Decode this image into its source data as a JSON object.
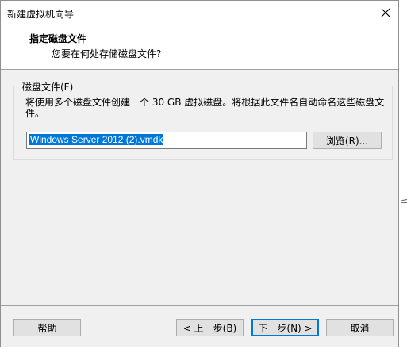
{
  "window": {
    "title": "新建虚拟机向导"
  },
  "header": {
    "title": "指定磁盘文件",
    "subtitle": "您要在何处存储磁盘文件?"
  },
  "disk_group": {
    "legend": "磁盘文件(F)",
    "description": "将使用多个磁盘文件创建一个 30 GB 虚拟磁盘。将根据此文件名自动命名这些磁盘文件。",
    "file_value": "Windows Server 2012 (2).vmdk",
    "browse_label": "浏览(R)..."
  },
  "footer": {
    "help_label": "帮助",
    "back_label": "< 上一步(B)",
    "next_label": "下一步(N) >",
    "cancel_label": "取消"
  },
  "edge_text": "千",
  "colors": {
    "accent": "#0078d7",
    "dialog_bg": "#f0f0f0"
  }
}
